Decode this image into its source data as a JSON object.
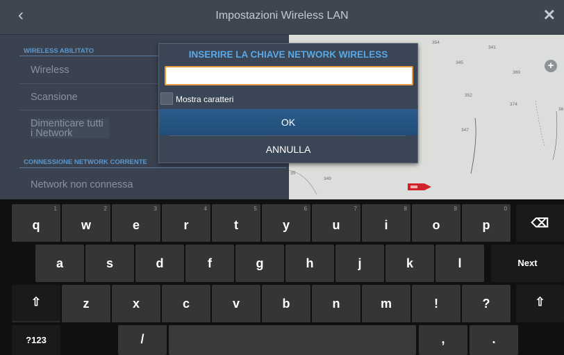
{
  "window": {
    "title": "Impostazioni Wireless LAN",
    "back_icon": "‹",
    "close_icon": "✕"
  },
  "settings": {
    "section_wireless": "WIRELESS ABILITATO",
    "wireless_label": "Wireless",
    "scan_label": "Scansione",
    "forget_line1": "Dimenticare tutti",
    "forget_line2": "i Network",
    "section_connection": "CONNESSIONE NETWORK CORRENTE",
    "network_status": "Network non connessa"
  },
  "map": {
    "depths": [
      "354",
      "341",
      "345",
      "369",
      "352",
      "374",
      "36",
      "347",
      "349",
      "35"
    ],
    "zoom_in_label": "+"
  },
  "dialog": {
    "title": "INSERIRE LA CHIAVE NETWORK WIRELESS",
    "input_value": "",
    "show_chars_label": "Mostra caratteri",
    "show_chars_checked": false,
    "ok_label": "OK",
    "cancel_label": "ANNULLA"
  },
  "keyboard": {
    "row1": [
      {
        "key": "q",
        "hint": "1"
      },
      {
        "key": "w",
        "hint": "2"
      },
      {
        "key": "e",
        "hint": "3"
      },
      {
        "key": "r",
        "hint": "4"
      },
      {
        "key": "t",
        "hint": "5"
      },
      {
        "key": "y",
        "hint": "6"
      },
      {
        "key": "u",
        "hint": "7"
      },
      {
        "key": "i",
        "hint": "8"
      },
      {
        "key": "o",
        "hint": "9"
      },
      {
        "key": "p",
        "hint": "0"
      }
    ],
    "backspace_icon": "⌫",
    "row2": [
      "a",
      "s",
      "d",
      "f",
      "g",
      "h",
      "j",
      "k",
      "l"
    ],
    "next_label": "Next",
    "shift_icon": "⇧",
    "row3": [
      "z",
      "x",
      "c",
      "v",
      "b",
      "n",
      "m",
      "!",
      "?"
    ],
    "symbols_label": "?123",
    "slash": "/",
    "comma": ",",
    "period": "."
  }
}
